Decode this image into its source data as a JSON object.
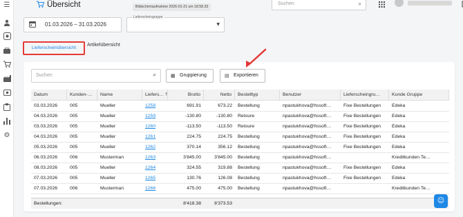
{
  "header": {
    "title": "Übersicht",
    "tooltip": "Bildschirmaufnahme 2026-01-21 um 18.58.33",
    "search_placeholder": "Suchen"
  },
  "filters": {
    "date_range": "01.03.2026 – 31.03.2026",
    "group_label": "Lieferscheingruppe"
  },
  "tabs": [
    {
      "label": "Lieferscheinübersicht",
      "active": true
    },
    {
      "label": "Artikelübersicht",
      "active": false
    }
  ],
  "toolbar": {
    "search_placeholder": "Suchen",
    "group_label": "Gruppierung",
    "export_label": "Exportieren"
  },
  "table": {
    "columns": [
      "Datum",
      "Kunden-…",
      "Name",
      "Liefers…",
      "Brutto",
      "Netto",
      "Bestelltyp",
      "Benutzer",
      "Lieferscheingru…",
      "Kunde Gruppe"
    ],
    "rows": [
      [
        "03.03.2026",
        "005",
        "Mueller",
        "1258",
        "691.91",
        "673.22",
        "Bestellung",
        "npastukhova@hssoft…",
        "Fixe Bestellungen",
        "Edeka"
      ],
      [
        "04.03.2026",
        "005",
        "Mueller",
        "1259",
        "-130.80",
        "-130.80",
        "Retoure",
        "npastukhova@hssoft…",
        "Fixe Bestellungen",
        "Edeka"
      ],
      [
        "03.03.2026",
        "005",
        "Mueller",
        "1260",
        "-113.50",
        "-113.50",
        "Retoure",
        "npastukhova@hssoft…",
        "Fixe Bestellungen",
        "Edeka"
      ],
      [
        "04.03.2026",
        "005",
        "Mueller",
        "1261",
        "224.75",
        "224.75",
        "Bestellung",
        "npastukhova@hssoft…",
        "Fixe Bestellungen",
        "Edeka"
      ],
      [
        "05.03.2026",
        "005",
        "Mueller",
        "1262",
        "370.14",
        "356.12",
        "Bestellung",
        "npastukhova@hssoft…",
        "Fixe Bestellungen",
        "Edeka"
      ],
      [
        "06.03.2026",
        "006",
        "Musterman",
        "1263",
        "3'845.00",
        "3'845.00",
        "Bestellung",
        "npastukhova@hssoft…",
        "",
        "Kreditkunden Te…"
      ],
      [
        "08.03.2026",
        "005",
        "Mueller",
        "1264",
        "324.55",
        "319.88",
        "Bestellung",
        "npastukhova@hssoft…",
        "Fixe Bestellungen",
        "Edeka"
      ],
      [
        "07.03.2026",
        "005",
        "Mueller",
        "1265",
        "130.76",
        "126.08",
        "Bestellung",
        "npastukhova@hssoft…",
        "Fixe Bestellungen",
        "Edeka"
      ],
      [
        "07.03.2026",
        "006",
        "Musterman",
        "1266",
        "475.00",
        "475.00",
        "Bestellung",
        "npastukhova@hssoft…",
        "",
        "Kreditkunden Te…"
      ]
    ],
    "footer": {
      "label": "Bestellungen:",
      "brutto": "8'418.38",
      "netto": "8'373.53"
    }
  },
  "colors": {
    "accent": "#1e88e5",
    "highlight": "#e53935"
  },
  "icons": [
    "menu-icon",
    "user-icon",
    "target-icon",
    "briefcase-icon",
    "cart-icon",
    "factory-icon",
    "money-icon",
    "clipboard-icon",
    "bar-chart-icon",
    "gear-icon"
  ]
}
